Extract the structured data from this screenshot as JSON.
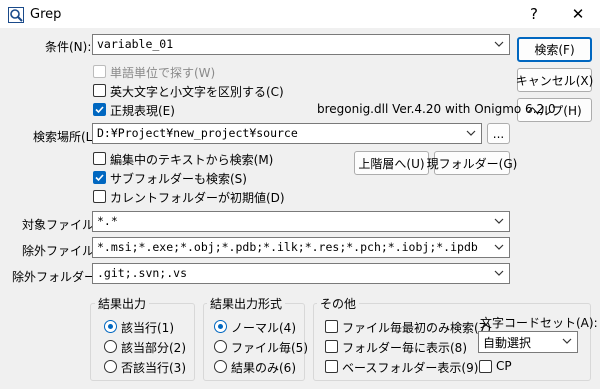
{
  "window": {
    "title": "Grep",
    "help_glyph": "?",
    "close_glyph": "✕"
  },
  "condition": {
    "label": "条件(N):",
    "value": "variable_01"
  },
  "options": {
    "word_unit": "単語単位で探す(W)",
    "case_sensitive": "英大文字と小文字を区別する(C)",
    "regex": "正規表現(E)"
  },
  "regex_engine_info": "bregonig.dll Ver.4.20 with Onigmo 6.2.0",
  "search_location": {
    "label": "検索場所(L):",
    "value": "D:¥Project¥new_project¥source",
    "browse_label": "..."
  },
  "search_options": {
    "from_editing_text": "編集中のテキストから検索(M)",
    "include_subfolders": "サブフォルダーも検索(S)",
    "current_folder_initial": "カレントフォルダーが初期値(D)"
  },
  "folder_buttons": {
    "up": "上階層へ(U)",
    "current": "現フォルダー(G)"
  },
  "target_file": {
    "label": "対象ファイル(I):",
    "value": "*.*"
  },
  "exclude_file": {
    "label": "除外ファイル(I):",
    "value": "*.msi;*.exe;*.obj;*.pdb;*.ilk;*.res;*.pch;*.iobj;*.ipdb"
  },
  "exclude_folder": {
    "label": "除外フォルダー(K):",
    "value": ".git;.svn;.vs"
  },
  "result_output": {
    "title": "結果出力",
    "items": [
      "該当行(1)",
      "該当部分(2)",
      "否該当行(3)"
    ]
  },
  "result_format": {
    "title": "結果出力形式",
    "items": [
      "ノーマル(4)",
      "ファイル毎(5)",
      "結果のみ(6)"
    ]
  },
  "other": {
    "title": "その他",
    "items": [
      "ファイル毎最初のみ検索(7)",
      "フォルダー毎に表示(8)",
      "ベースフォルダー表示(9)"
    ]
  },
  "charset": {
    "label": "文字コードセット(A):",
    "value": "自動選択",
    "cp_label": "CP"
  },
  "buttons": {
    "search": "検索(F)",
    "cancel": "キャンセル(X)",
    "help": "ヘルプ(H)"
  }
}
